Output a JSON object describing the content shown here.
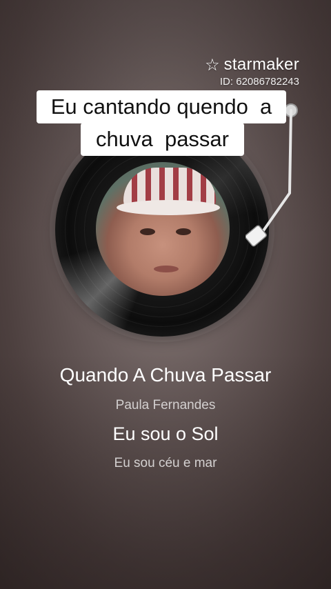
{
  "brand": {
    "logo_icon": "starmaker-star-icon",
    "name": "starmaker",
    "id_text": "ID: 62086782243"
  },
  "caption": {
    "line1": "Eu cantando quendo  a",
    "line2": "chuva  passar"
  },
  "player": {
    "record_icon": "vinyl-record",
    "tonearm_icon": "tonearm-icon"
  },
  "song": {
    "title": "Quando A Chuva Passar",
    "artist": "Paula Fernandes"
  },
  "lyrics": {
    "current": "Eu sou o Sol",
    "next": "Eu sou céu e mar"
  },
  "colors": {
    "background": "#6a5d5c",
    "caption_bg": "#ffffff",
    "text": "#ffffff"
  }
}
